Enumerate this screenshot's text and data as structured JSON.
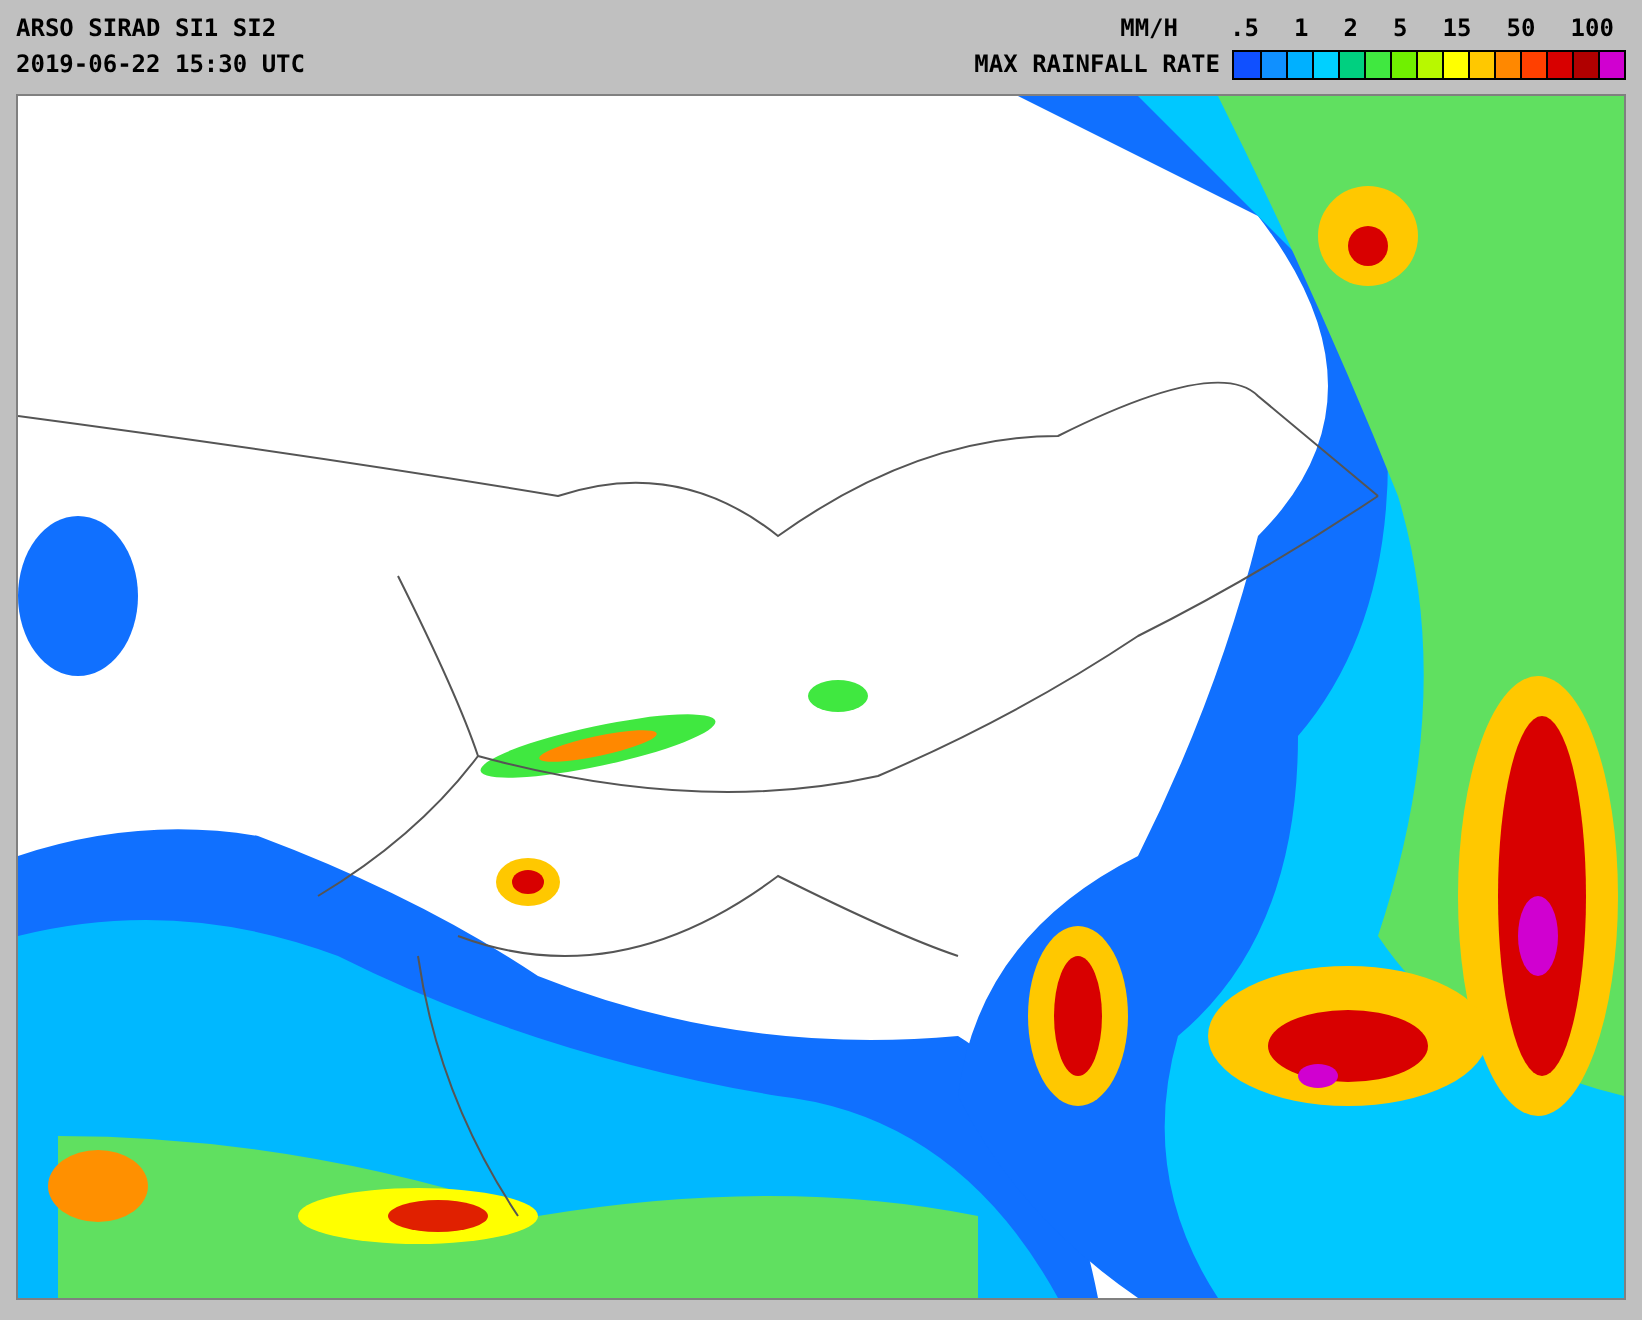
{
  "header": {
    "title": "ARSO SIRAD SI1 SI2",
    "timestamp": "2019-06-22 15:30 UTC"
  },
  "legend": {
    "unit": "MM/H",
    "title": "MAX RAINFALL RATE",
    "ticks": [
      ".5",
      "1",
      "2",
      "5",
      "15",
      "50",
      "100"
    ],
    "swatches": [
      {
        "color": "#1050ff"
      },
      {
        "color": "#1090ff"
      },
      {
        "color": "#00b0ff"
      },
      {
        "color": "#00d0ff"
      },
      {
        "color": "#00d080"
      },
      {
        "color": "#40e840"
      },
      {
        "color": "#70f000"
      },
      {
        "color": "#b8f800"
      },
      {
        "color": "#ffff00"
      },
      {
        "color": "#ffc800"
      },
      {
        "color": "#ff8800"
      },
      {
        "color": "#ff4000"
      },
      {
        "color": "#d80000"
      },
      {
        "color": "#b00000"
      },
      {
        "color": "#d000d0"
      }
    ]
  }
}
